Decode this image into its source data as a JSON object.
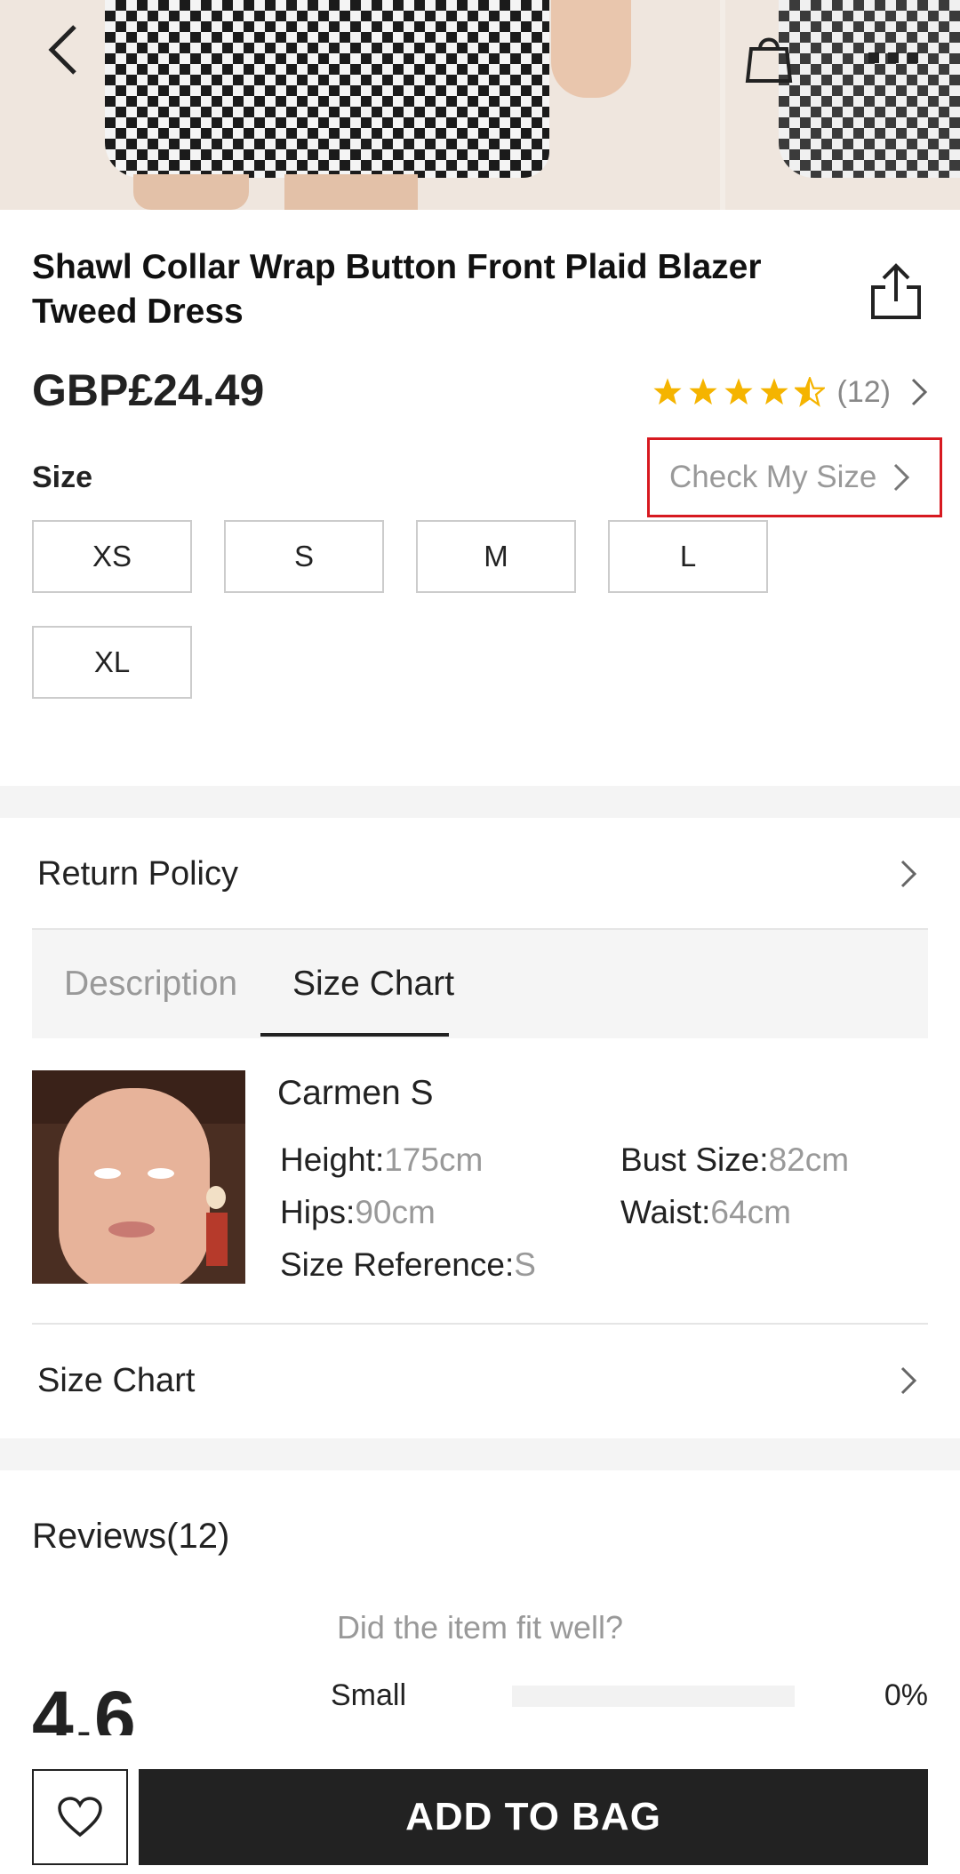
{
  "header": {
    "back_icon": "chevron-left-icon",
    "bag_icon": "shopping-bag-icon",
    "more_icon": "more-dots-icon"
  },
  "product": {
    "title": "Shawl Collar Wrap Button Front Plaid Blazer Tweed Dress",
    "price": "GBP£24.49",
    "rating": 4.5,
    "rating_count": "(12)",
    "share_icon": "share-icon"
  },
  "size": {
    "label": "Size",
    "check_my_size": "Check My Size",
    "options": [
      "XS",
      "S",
      "M",
      "L",
      "XL"
    ]
  },
  "links": {
    "return_policy": "Return Policy",
    "size_chart": "Size Chart"
  },
  "tabs": {
    "items": [
      "Description",
      "Size Chart"
    ],
    "active": "Size Chart"
  },
  "model": {
    "name": "Carmen S",
    "height_label": "Height:",
    "height_value": "175cm",
    "bust_label": "Bust Size:",
    "bust_value": "82cm",
    "hips_label": "Hips:",
    "hips_value": "90cm",
    "waist_label": "Waist:",
    "waist_value": "64cm",
    "size_ref_label": "Size Reference:",
    "size_ref_value": "S"
  },
  "reviews": {
    "title": "Reviews(12)",
    "score": "4.6",
    "fit_question": "Did the item fit well?",
    "fit_rows": [
      {
        "label": "Small",
        "percent": "0%",
        "fraction": 0
      }
    ]
  },
  "bottom": {
    "wishlist_icon": "heart-icon",
    "add_to_bag": "ADD TO BAG"
  },
  "colors": {
    "accent_red": "#d71920",
    "star_gold": "#f5b400",
    "dark": "#222222"
  }
}
